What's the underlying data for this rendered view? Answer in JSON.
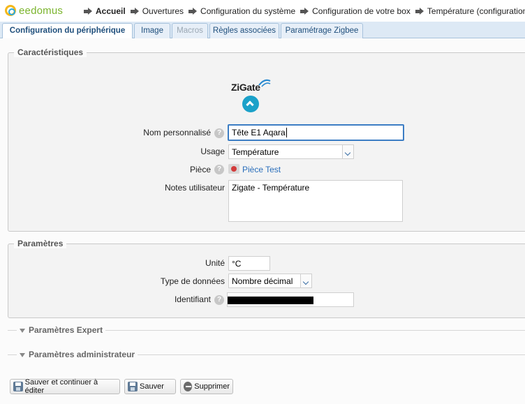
{
  "app": {
    "logo_text": "eedomus"
  },
  "breadcrumb": [
    "Accueil",
    "Ouvertures",
    "Configuration du système",
    "Configuration de votre box",
    "Température (configuration)"
  ],
  "tabs": [
    "Configuration du périphérique",
    "Image",
    "Macros",
    "Règles associées",
    "Paramétrage Zigbee"
  ],
  "caracteristiques": {
    "legend": "Caractéristiques",
    "brand_logo_text": "ZiGate",
    "name_label": "Nom personnalisé",
    "name_value": "Tête E1 Aqara",
    "usage_label": "Usage",
    "usage_value": "Température",
    "room_label": "Pièce",
    "room_value": "Pièce Test",
    "notes_label": "Notes utilisateur",
    "notes_value": "Zigate - Température"
  },
  "parametres": {
    "legend": "Paramètres",
    "unit_label": "Unité",
    "unit_value": "°C",
    "data_type_label": "Type de données",
    "data_type_value": "Nombre décimal",
    "identifier_label": "Identifiant"
  },
  "sections": {
    "expert": "Paramètres Expert",
    "admin": "Paramètres administrateur"
  },
  "buttons": {
    "save_continue": "Sauver et continuer à éditer",
    "save": "Sauver",
    "delete": "Supprimer"
  },
  "colors": {
    "accent": "#1f4f7c",
    "tab_bg": "#dde9f5",
    "logo_green": "#7ab42c",
    "link_blue": "#2a6ebb"
  }
}
